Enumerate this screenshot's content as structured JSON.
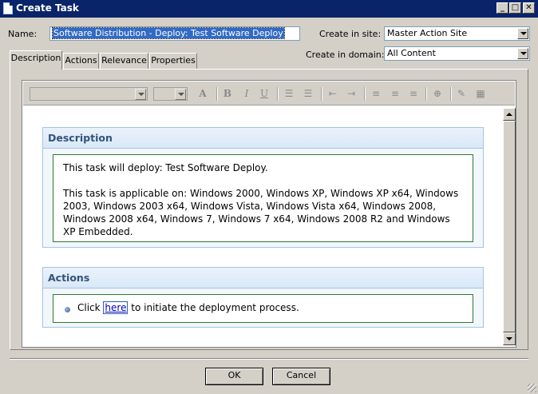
{
  "window": {
    "title": "Create Task",
    "minimize_glyph": "_",
    "maximize_glyph": "□",
    "close_glyph": "✕"
  },
  "form": {
    "name_label": "Name:",
    "name_value": "Software Distribution - Deploy: Test Software Deploy",
    "site_label": "Create in site:",
    "site_value": "Master Action Site",
    "domain_label": "Create in domain:",
    "domain_value": "All Content"
  },
  "tabs": [
    {
      "label": "Description",
      "active": true
    },
    {
      "label": "Actions",
      "active": false
    },
    {
      "label": "Relevance",
      "active": false
    },
    {
      "label": "Properties",
      "active": false
    }
  ],
  "toolbar": {
    "font_family_value": "",
    "font_size_value": "",
    "icons": [
      "font-color-icon",
      "bold-icon",
      "italic-icon",
      "underline-icon",
      "numbered-list-icon",
      "bullet-list-icon",
      "outdent-icon",
      "indent-icon",
      "align-left-icon",
      "align-center-icon",
      "align-right-icon",
      "insert-link-icon",
      "clean-format-icon",
      "table-icon"
    ],
    "glyphs": {
      "font_color": "A",
      "bold": "B",
      "italic": "I",
      "underline": "U",
      "numbered_list": "☰",
      "bullet_list": "☰",
      "outdent": "⇤",
      "indent": "⇥",
      "align_left": "≡",
      "align_center": "≡",
      "align_right": "≡",
      "link": "⊕",
      "clean": "✎",
      "table": "▦"
    }
  },
  "content": {
    "description_heading": "Description",
    "description_line1": "This task will deploy: Test Software Deploy.",
    "description_line2": "This task is applicable on: Windows 2000, Windows XP, Windows XP x64, Windows 2003, Windows 2003 x64, Windows Vista, Windows Vista x64, Windows 2008, Windows 2008 x64, Windows 7, Windows 7 x64, Windows 2008 R2 and Windows XP Embedded.",
    "actions_heading": "Actions",
    "action_prefix": "Click",
    "action_link": "here",
    "action_suffix": "to initiate the deployment process."
  },
  "buttons": {
    "ok": "OK",
    "cancel": "Cancel"
  },
  "colors": {
    "title_bar": "#0a246a",
    "dialog_bg": "#d4d0c8",
    "section_head_text": "#34527a",
    "section_border": "#2f7a2f",
    "link": "#0000c0"
  }
}
